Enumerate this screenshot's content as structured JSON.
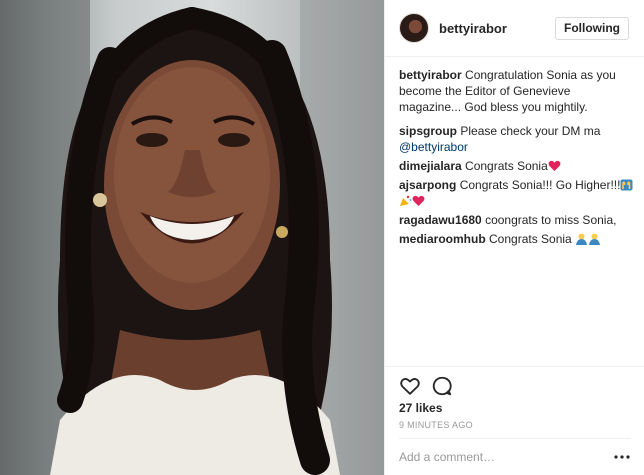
{
  "post": {
    "author": "bettyirabor",
    "follow_label": "Following"
  },
  "caption": {
    "user": "bettyirabor",
    "text": "Congratulation Sonia as you become the Editor of Genevieve magazine... God bless you mightily."
  },
  "comments": [
    {
      "user": "sipsgroup",
      "text": "Please check your DM ma",
      "mention": "@bettyirabor"
    },
    {
      "user": "dimejialara",
      "text": "Congrats Sonia"
    },
    {
      "user": "ajsarpong",
      "text": "Congrats Sonia!!! Go Higher!!!"
    },
    {
      "user": "ragadawu1680",
      "text": "coongrats to miss Sonia,"
    },
    {
      "user": "mediaroomhub",
      "text": "Congrats Sonia"
    }
  ],
  "engagement": {
    "likes": "27 likes",
    "time": "9 MINUTES AGO"
  },
  "comment_box": {
    "placeholder": "Add a comment…"
  },
  "icons": {
    "like": "heart-icon",
    "comment": "comment-icon",
    "more": "more-options-icon"
  },
  "colors": {
    "text": "#262626",
    "muted": "#999999",
    "link": "#003569",
    "border": "#efefef",
    "heart_emoji": "#e0245e"
  }
}
